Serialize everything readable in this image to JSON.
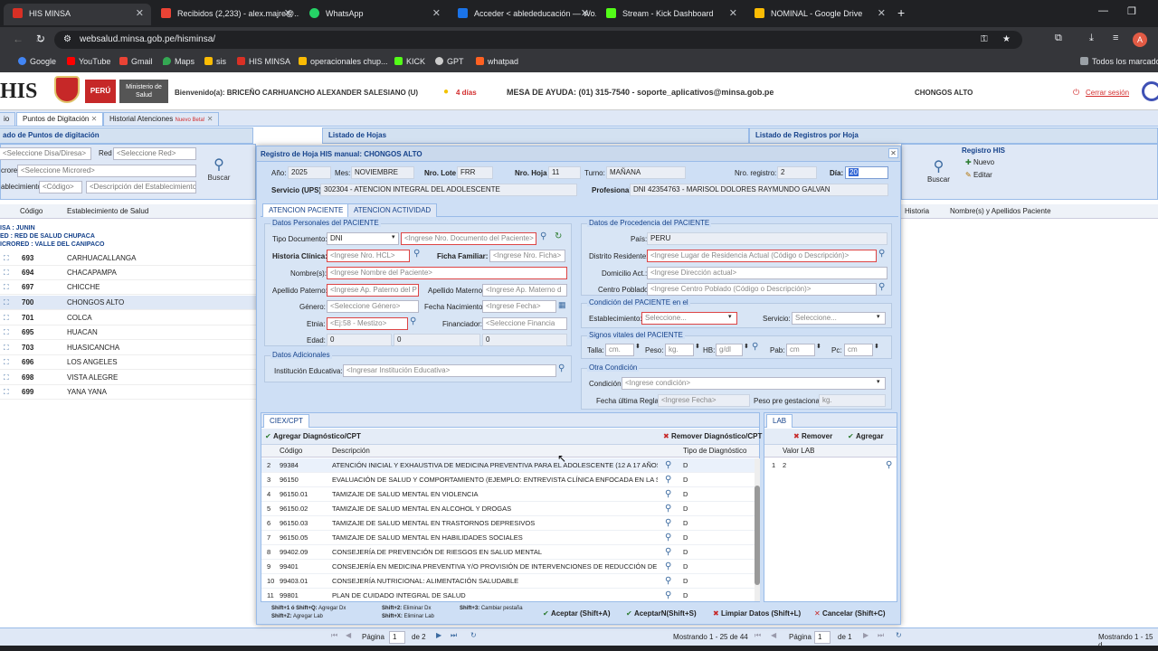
{
  "browser": {
    "tabs": [
      {
        "label": "HIS MINSA",
        "color": "#d93025"
      },
      {
        "label": "Recibidos (2,233) - alex.majre@...",
        "color": "#ea4335"
      },
      {
        "label": "WhatsApp",
        "color": "#25d366"
      },
      {
        "label": "Acceder < ablededucación — Wo...",
        "color": "#1a73e8"
      },
      {
        "label": "Stream - Kick Dashboard",
        "color": "#53fc18"
      },
      {
        "label": "NOMINAL - Google Drive",
        "color": "#fbbc04"
      }
    ],
    "url": "websalud.minsa.gob.pe/hisminsa/",
    "bookmarks": [
      "Google",
      "YouTube",
      "Gmail",
      "Maps",
      "sis",
      "HIS MINSA",
      "operacionales chup...",
      "KICK",
      "GPT",
      "whatpad"
    ],
    "all_bookmarks": "Todos los marcadores",
    "avatar_letter": "A"
  },
  "header": {
    "logo": "HIS",
    "peru": "PERÚ",
    "ministry": "Ministerio de Salud",
    "welcome": "Bienvenido(a): BRICEÑO CARHUANCHO ALEXANDER SALESIANO (U)",
    "days": "4 días",
    "help": "MESA DE AYUDA: (01) 315-7540 - soporte_aplicativos@minsa.gob.pe",
    "location": "CHONGOS ALTO",
    "logout": "Cerrar sesión"
  },
  "navtabs": [
    "io",
    "Puntos de Digitación",
    "Historial Atenciones",
    "Nuevo Beta!"
  ],
  "left": {
    "title": "ado de Puntos de digitación",
    "red_label": "Red",
    "diresa_ph": "<Seleccione Disa/Diresa>",
    "red_ph": "<Seleccione Red>",
    "microred_label": "crored",
    "microred_ph": "<Seleccione Microred>",
    "estab_label": "ablecimiento:",
    "codigo_ph": "<Código>",
    "desc_ph": "<Descripción del Establecimiento>",
    "search": "Buscar",
    "col_codigo": "Código",
    "col_estab": "Establecimiento de Salud",
    "tree": [
      "ISA      : JUNIN",
      "ED       : RED DE SALUD CHUPACA",
      "ICRORED : VALLE DEL CANIPACO"
    ],
    "rows": [
      {
        "code": "693",
        "name": "CARHUACALLANGA"
      },
      {
        "code": "694",
        "name": "CHACAPAMPA"
      },
      {
        "code": "697",
        "name": "CHICCHE"
      },
      {
        "code": "700",
        "name": "CHONGOS ALTO"
      },
      {
        "code": "701",
        "name": "COLCA"
      },
      {
        "code": "695",
        "name": "HUACAN"
      },
      {
        "code": "703",
        "name": "HUASICANCHA"
      },
      {
        "code": "696",
        "name": "LOS ANGELES"
      },
      {
        "code": "698",
        "name": "VISTA ALEGRE"
      },
      {
        "code": "699",
        "name": "YANA YANA"
      }
    ]
  },
  "middle": {
    "title": "Listado de Hojas"
  },
  "right": {
    "title": "Listado de Registros por Hoja",
    "registro": "Registro HIS",
    "nuevo": "Nuevo",
    "editar": "Editar",
    "search": "Buscar",
    "col_historia": "Historia",
    "col_nombre": "Nombre(s) y Apellidos Paciente"
  },
  "modal": {
    "title": "Registro de Hoja HIS manual: CHONGOS ALTO",
    "anio_label": "Año:",
    "anio": "2025",
    "mes_label": "Mes:",
    "mes": "NOVIEMBRE",
    "lote_label": "Nro. Lote",
    "lote": "FRR",
    "hoja_label": "Nro. Hoja",
    "hoja": "11",
    "turno_label": "Turno:",
    "turno": "MAÑANA",
    "registro_label": "Nro. registro:",
    "registro": "2",
    "dia_label": "Día:",
    "dia": "20",
    "servicio_label": "Servicio (UPS):",
    "servicio": "302304 - ATENCION INTEGRAL DEL ADOLESCENTE",
    "profesional_label": "Profesional:",
    "profesional": "DNI 42354763 - MARISOL DOLORES RAYMUNDO GALVAN",
    "tab1": "ATENCION PACIENTE",
    "tab2": "ATENCION ACTIVIDAD",
    "personal": {
      "legend": "Datos Personales del PACIENTE",
      "tipo_doc_label": "Tipo Documento:",
      "tipo_doc": "DNI",
      "nro_doc_ph": "<Ingrese Nro. Documento del Paciente>",
      "hcl_label": "Historia Clínica:",
      "hcl_ph": "<Ingrese Nro. HCL>",
      "ficha_label": "Ficha Familiar:",
      "ficha_ph": "<Ingrese Nro. Ficha>",
      "nombres_label": "Nombre(s):",
      "nombres_ph": "<Ingrese Nombre del Paciente>",
      "ap_pat_label": "Apellido Paterno:",
      "ap_pat_ph": "<Ingrese Ap. Paterno del P",
      "ap_mat_label": "Apellido Materno:",
      "ap_mat_ph": "<Ingrese Ap. Materno d",
      "genero_label": "Género:",
      "genero_ph": "<Seleccione Género>",
      "fecha_nac_label": "Fecha Nacimiento:",
      "fecha_nac_ph": "<Ingrese Fecha>",
      "etnia_label": "Etnia:",
      "etnia_ph": "<Ej:58 - Mestizo>",
      "financiador_label": "Financiador:",
      "financiador_ph": "<Seleccione Financia",
      "edad_label": "Edad:",
      "edad": [
        "0",
        "0",
        "0"
      ]
    },
    "adicionales": {
      "legend": "Datos Adicionales",
      "inst_label": "Institución Educativa:",
      "inst_ph": "<Ingresar Institución Educativa>"
    },
    "procedencia": {
      "legend": "Datos de Procedencia del PACIENTE",
      "pais_label": "País:",
      "pais": "PERU",
      "distrito_label": "Distrito Residente:",
      "distrito_ph": "<Ingrese Lugar de Residencia Actual (Código o Descripción)>",
      "domicilio_label": "Domicilio Act.:",
      "domicilio_ph": "<Ingrese Dirección actual>",
      "centro_label": "Centro Poblado:",
      "centro_ph": "<Ingrese Centro Poblado (Código o Descripción)>"
    },
    "condicion": {
      "legend": "Condición del PACIENTE en el",
      "estab_label": "Establecimiento:",
      "estab_ph": "Seleccione...",
      "servicio_label": "Servicio:",
      "servicio_ph": "Seleccione..."
    },
    "signos": {
      "legend": "Signos vitales del PACIENTE",
      "talla_label": "Talla:",
      "talla_ph": "cm.",
      "peso_label": "Peso:",
      "peso_ph": "kg.",
      "hb_label": "HB:",
      "hb_ph": "g/dl",
      "pab_label": "Pab:",
      "pab_ph": "cm",
      "pc_label": "Pc:",
      "pc_ph": "cm"
    },
    "otra": {
      "legend": "Otra Condición",
      "condicion_label": "Condición:",
      "condicion_ph": "<Ingrese condición>",
      "fur_label": "Fecha última Regla:",
      "fur_ph": "<Ingrese Fecha>",
      "peso_gest_label": "Peso pre gestacional:",
      "peso_gest_ph": "kg."
    },
    "ciex": {
      "tab": "CIEX/CPT",
      "add": "Agregar Diagnóstico/CPT",
      "remove": "Remover Diagnóstico/CPT",
      "col_codigo": "Código",
      "col_desc": "Descripción",
      "col_tipo": "Tipo de Diagnóstico",
      "rows": [
        {
          "n": "2",
          "code": "99384",
          "desc": "ATENCIÓN INICIAL Y EXHAUSTIVA DE MEDICINA PREVENTIVA PARA EL ADOLESCENTE (12 A 17 AÑOS)",
          "tipo": "D"
        },
        {
          "n": "3",
          "code": "96150",
          "desc": "EVALUACIÓN DE SALUD Y COMPORTAMIENTO (EJEMPLO: ENTREVISTA CLÍNICA ENFOCADA EN LA SALU...",
          "tipo": "D"
        },
        {
          "n": "4",
          "code": "96150.01",
          "desc": "TAMIZAJE DE SALUD MENTAL EN VIOLENCIA",
          "tipo": "D"
        },
        {
          "n": "5",
          "code": "96150.02",
          "desc": "TAMIZAJE DE SALUD MENTAL EN ALCOHOL Y DROGAS",
          "tipo": "D"
        },
        {
          "n": "6",
          "code": "96150.03",
          "desc": "TAMIZAJE DE SALUD MENTAL EN TRASTORNOS DEPRESIVOS",
          "tipo": "D"
        },
        {
          "n": "7",
          "code": "96150.05",
          "desc": " TAMIZAJE DE SALUD MENTAL EN HABILIDADES SOCIALES",
          "tipo": "D"
        },
        {
          "n": "8",
          "code": "99402.09",
          "desc": "CONSEJERÍA DE PREVENCIÓN DE RIESGOS EN SALUD MENTAL",
          "tipo": "D"
        },
        {
          "n": "9",
          "code": "99401",
          "desc": "CONSEJERÍA EN MEDICINA PREVENTIVA Y/O PROVISIÓN DE INTERVENCIONES DE REDUCCIÓN DE FACT...",
          "tipo": "D"
        },
        {
          "n": "10",
          "code": "99403.01",
          "desc": "CONSEJERÍA NUTRICIONAL: ALIMENTACIÓN SALUDABLE",
          "tipo": "D"
        },
        {
          "n": "11",
          "code": "99801",
          "desc": "PLAN DE CUIDADO INTEGRAL DE SALUD",
          "tipo": "D"
        }
      ]
    },
    "lab": {
      "tab": "LAB",
      "remove": "Remover",
      "add": "Agregar",
      "col": "Valor LAB",
      "row_n": "1",
      "row_val": "2"
    },
    "footer": {
      "hint1a": "Shift+1 ó Shift+Q:",
      "hint1b": "Agregar Dx",
      "hint1c": "Shift+Z:",
      "hint1d": "Agregar Lab",
      "hint2a": "Shift+2:",
      "hint2b": "Eliminar Dx",
      "hint2c": "Shift+X:",
      "hint2d": "Eliminar Lab",
      "hint3a": "Shift+3:",
      "hint3b": "Cambiar pestaña",
      "aceptar": "Aceptar (Shift+A)",
      "aceptarn": "AceptarN(Shift+S)",
      "limpiar": "Limpiar Datos (Shift+L)",
      "cancelar": "Cancelar (Shift+C)"
    }
  },
  "paging": {
    "pagina": "Página",
    "page": "1",
    "de": "de 2",
    "mostrando": "Mostrando 1 - 25 de 44",
    "pagina2": "Página",
    "page2": "1",
    "de2": "de 1",
    "mostrando2": "Mostrando 1 - 15 d"
  }
}
